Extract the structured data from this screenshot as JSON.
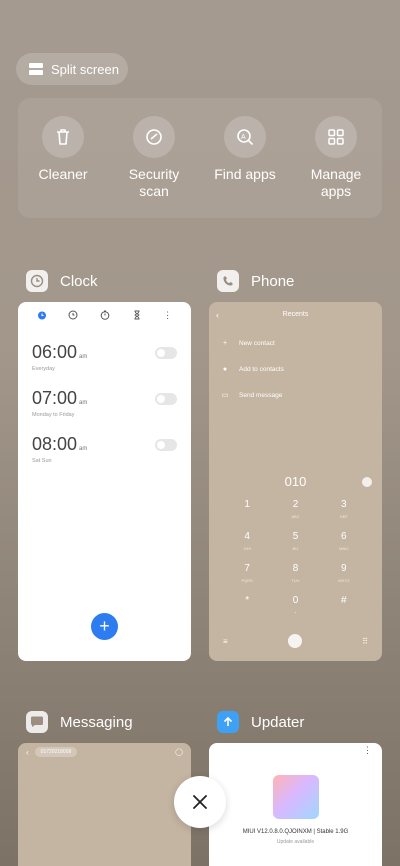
{
  "split_screen": {
    "label": "Split screen"
  },
  "quick_actions": [
    {
      "label": "Cleaner",
      "icon": "trash-icon"
    },
    {
      "label": "Security scan",
      "icon": "shield-check-icon"
    },
    {
      "label": "Find apps",
      "icon": "search-app-icon"
    },
    {
      "label": "Manage apps",
      "icon": "grid-icon"
    }
  ],
  "apps": {
    "clock": {
      "title": "Clock",
      "alarms": [
        {
          "time": "06:00",
          "ampm": "am",
          "days": "Everyday"
        },
        {
          "time": "07:00",
          "ampm": "am",
          "days": "Monday to Friday"
        },
        {
          "time": "08:00",
          "ampm": "am",
          "days": "Sat Sun"
        }
      ],
      "add_label": "+"
    },
    "phone": {
      "title": "Phone",
      "header": "Recents",
      "actions": [
        "New contact",
        "Add to contacts",
        "Send message"
      ],
      "number": "010",
      "keys": [
        {
          "digit": "1",
          "letters": ""
        },
        {
          "digit": "2",
          "letters": "ABC"
        },
        {
          "digit": "3",
          "letters": "DEF"
        },
        {
          "digit": "4",
          "letters": "GHI"
        },
        {
          "digit": "5",
          "letters": "JKL"
        },
        {
          "digit": "6",
          "letters": "MNO"
        },
        {
          "digit": "7",
          "letters": "PQRS"
        },
        {
          "digit": "8",
          "letters": "TUV"
        },
        {
          "digit": "9",
          "letters": "WXYZ"
        },
        {
          "digit": "*",
          "letters": ""
        },
        {
          "digit": "0",
          "letters": "+"
        },
        {
          "digit": "#",
          "letters": ""
        }
      ]
    },
    "messaging": {
      "title": "Messaging",
      "pill": "01720218009"
    },
    "updater": {
      "title": "Updater",
      "version": "MIUI V12.0.8.0.QJOINXM | Stable 1.9G",
      "status": "Update available"
    }
  },
  "close": {
    "label": "×"
  },
  "colors": {
    "accent": "#2d7df0",
    "updater_icon": "#3fa1f5"
  }
}
